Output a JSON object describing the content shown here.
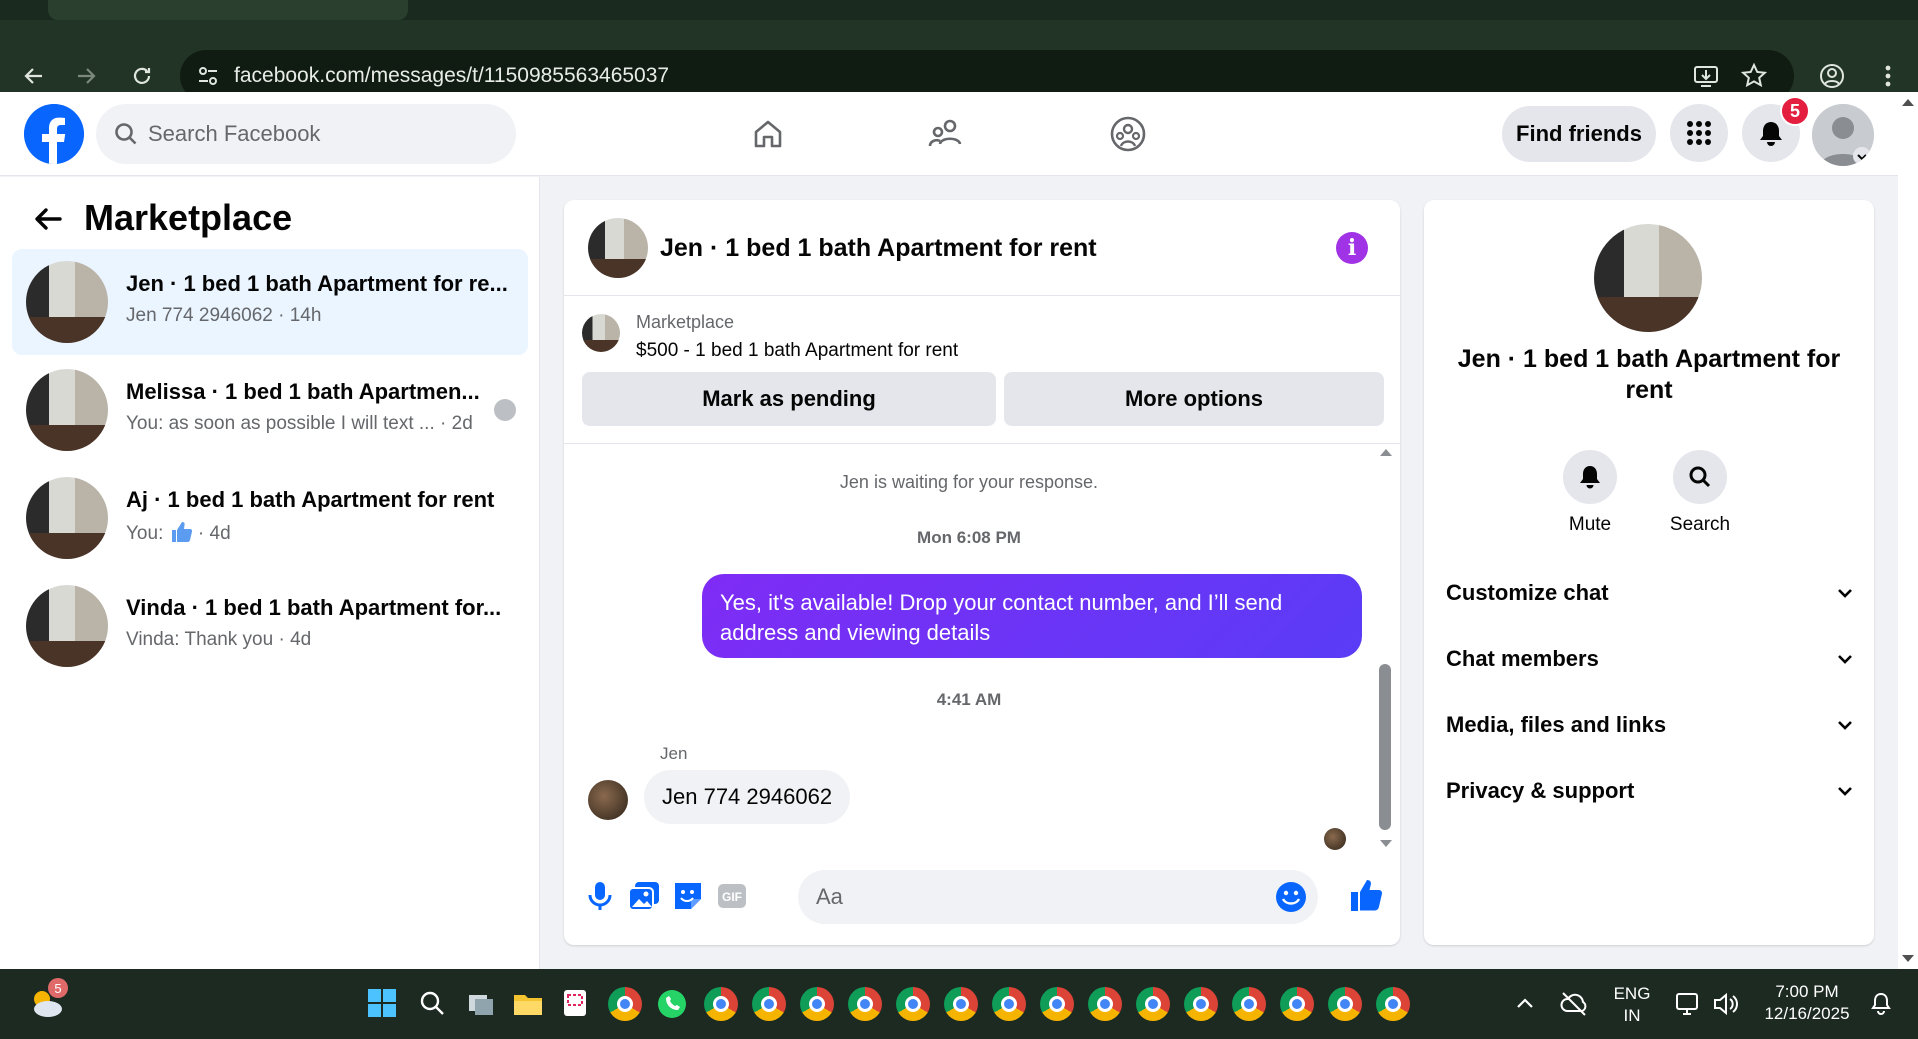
{
  "browser": {
    "url": "facebook.com/messages/t/1150985563465037"
  },
  "fb": {
    "search_placeholder": "Search Facebook",
    "find_friends": "Find friends",
    "notification_count": "5"
  },
  "left": {
    "title": "Marketplace",
    "conversations": [
      {
        "name": "Jen · 1 bed 1 bath Apartment for re...",
        "sub": "Jen 774 2946062 · 14h",
        "active": true
      },
      {
        "name": "Melissa · 1 bed 1 bath Apartmen...",
        "sub": "You: as soon as possible I will text ... · 2d"
      },
      {
        "name": "Aj · 1 bed 1 bath Apartment for rent",
        "sub_prefix": "You:",
        "sub_suffix": "· 4d"
      },
      {
        "name": "Vinda · 1 bed 1 bath Apartment for...",
        "sub": "Vinda: Thank you · 4d"
      }
    ]
  },
  "chat": {
    "title": "Jen · 1 bed 1 bath Apartment for rent",
    "marketplace_label": "Marketplace",
    "listing": "$500 - 1 bed 1 bath Apartment for rent",
    "mark_pending": "Mark as pending",
    "more_options": "More options",
    "waiting": "Jen is waiting for your response.",
    "ts1": "Mon 6:08 PM",
    "outgoing": "Yes, it's available! Drop your contact number, and I’ll send address and viewing details",
    "ts2": "4:41 AM",
    "sender": "Jen",
    "incoming": "Jen 774 2946062",
    "composer_placeholder": "Aa"
  },
  "right": {
    "name": "Jen · 1 bed 1 bath Apartment for rent",
    "mute": "Mute",
    "search": "Search",
    "sections": [
      "Customize chat",
      "Chat members",
      "Media, files and links",
      "Privacy & support"
    ]
  },
  "taskbar": {
    "weather_badge": "5",
    "lang_top": "ENG",
    "lang_bottom": "IN",
    "time": "7:00 PM",
    "date": "12/16/2025"
  },
  "colors": {
    "fb_blue": "#0866ff",
    "messenger_purple": "#6b3cf7",
    "badge_red": "#e41e3f"
  }
}
